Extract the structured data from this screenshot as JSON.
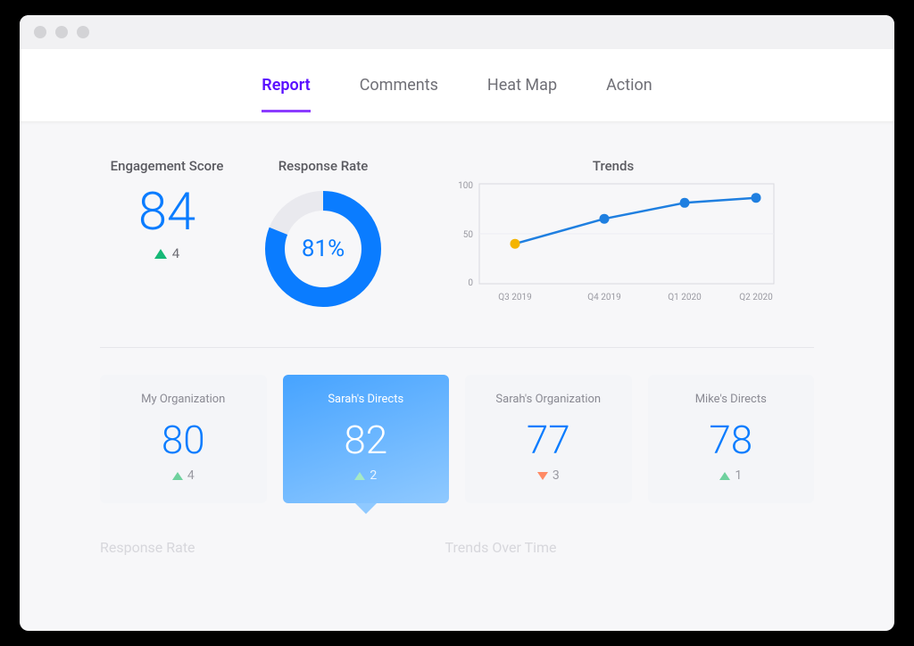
{
  "tabs": [
    {
      "label": "Report",
      "active": true
    },
    {
      "label": "Comments",
      "active": false
    },
    {
      "label": "Heat Map",
      "active": false
    },
    {
      "label": "Action",
      "active": false
    }
  ],
  "engagement": {
    "title": "Engagement Score",
    "score": "84",
    "delta": "4",
    "direction": "up"
  },
  "response_rate": {
    "title": "Response Rate",
    "value": "81%",
    "percent": 81
  },
  "trends": {
    "title": "Trends"
  },
  "chart_data": {
    "type": "line",
    "title": "Trends",
    "xlabel": "",
    "ylabel": "",
    "categories": [
      "Q3 2019",
      "Q4 2019",
      "Q1 2020",
      "Q2 2020"
    ],
    "values": [
      40,
      65,
      81,
      86
    ],
    "ylim": [
      0,
      100
    ],
    "yticks": [
      0,
      50,
      100
    ],
    "highlight_index": 0,
    "colors": {
      "line": "#1f7fe0",
      "point": "#1f7fe0",
      "highlight": "#f4b400"
    }
  },
  "cards": [
    {
      "title": "My Organization",
      "score": "80",
      "delta": "4",
      "direction": "up",
      "active": false
    },
    {
      "title": "Sarah's Directs",
      "score": "82",
      "delta": "2",
      "direction": "up",
      "active": true
    },
    {
      "title": "Sarah's Organization",
      "score": "77",
      "delta": "3",
      "direction": "down",
      "active": false
    },
    {
      "title": "Mike's Directs",
      "score": "78",
      "delta": "1",
      "direction": "up",
      "active": false
    }
  ],
  "bottom": {
    "left": "Response Rate",
    "right": "Trends Over Time"
  }
}
